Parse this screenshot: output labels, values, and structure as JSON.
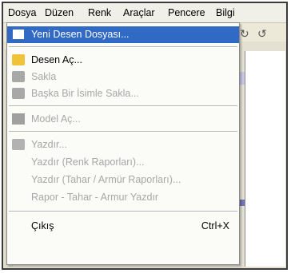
{
  "menubar": {
    "items": [
      "Dosya",
      "Düzen",
      "Renk",
      "Araçlar",
      "Pencere",
      "Bilgi"
    ]
  },
  "menu": {
    "items": [
      {
        "label": "Yeni Desen Dosyası...",
        "shortcut": "",
        "enabled": true,
        "highlighted": true,
        "icon": "new-document-icon"
      },
      {
        "label": "Desen Aç...",
        "shortcut": "",
        "enabled": true,
        "highlighted": false,
        "icon": "open-folder-icon"
      },
      {
        "label": "Sakla",
        "shortcut": "",
        "enabled": false,
        "highlighted": false,
        "icon": "save-icon"
      },
      {
        "label": "Başka Bir İsimle Sakla...",
        "shortcut": "",
        "enabled": false,
        "highlighted": false,
        "icon": "save-as-icon"
      },
      {
        "label": "Model Aç...",
        "shortcut": "",
        "enabled": false,
        "highlighted": false,
        "icon": "model-icon"
      },
      {
        "label": "Yazdır...",
        "shortcut": "",
        "enabled": false,
        "highlighted": false,
        "icon": "printer-icon"
      },
      {
        "label": "Yazdır (Renk Raporları)...",
        "shortcut": "",
        "enabled": false,
        "highlighted": false,
        "icon": ""
      },
      {
        "label": "Yazdır (Tahar / Armür Raporları)...",
        "shortcut": "",
        "enabled": false,
        "highlighted": false,
        "icon": ""
      },
      {
        "label": "Rapor - Tahar - Armur Yazdır",
        "shortcut": "",
        "enabled": false,
        "highlighted": false,
        "icon": ""
      },
      {
        "label": "Çıkış",
        "shortcut": "Ctrl+X",
        "enabled": true,
        "highlighted": false,
        "icon": ""
      }
    ]
  },
  "colors": {
    "highlight": "#316ac5",
    "disabled_text": "#a7a7a7",
    "menu_bg": "#fbfbf8"
  }
}
